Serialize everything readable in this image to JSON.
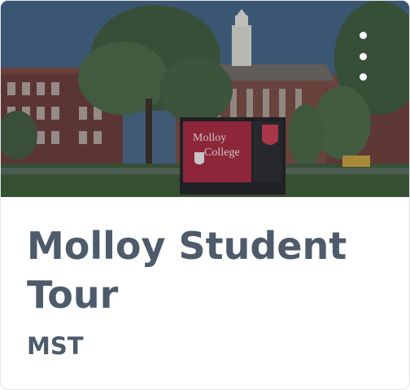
{
  "card": {
    "title": "Molloy Student Tour",
    "code": "MST",
    "image": {
      "description_icon": "campus-photo",
      "sign_line1": "Molloy",
      "sign_line2": "College"
    },
    "menu_icon": "vertical-ellipsis-icon"
  },
  "colors": {
    "title_text": "#4d5b6b",
    "sign_red": "#a8283a",
    "brick": "#7a3b30"
  }
}
